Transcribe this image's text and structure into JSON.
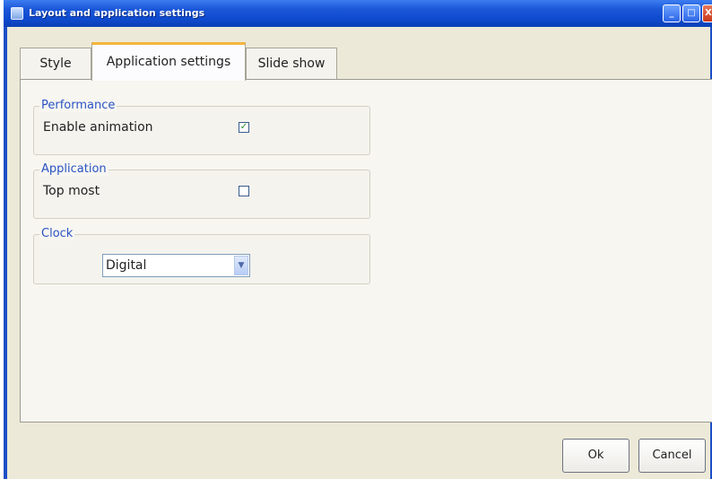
{
  "window": {
    "title": "Layout and application settings",
    "icon": "app-window-icon",
    "controls": {
      "minimize": "_",
      "maximize": "□",
      "close": "X"
    }
  },
  "tabs": [
    {
      "label": "Style",
      "selected": false
    },
    {
      "label": "Application settings",
      "selected": true
    },
    {
      "label": "Slide show",
      "selected": false
    }
  ],
  "groups": {
    "performance": {
      "legend": "Performance",
      "label": "Enable animation",
      "checked": true,
      "mark": "✓"
    },
    "application": {
      "legend": "Application",
      "label": "Top most",
      "checked": false,
      "mark": ""
    },
    "clock": {
      "legend": "Clock",
      "selected": "Digital",
      "arrow": "▼"
    }
  },
  "buttons": {
    "ok": "Ok",
    "cancel": "Cancel"
  },
  "colors": {
    "titlebar": "#0f4bcf",
    "accent_tab": "#f5b53e",
    "legend_text": "#2b54c4"
  }
}
